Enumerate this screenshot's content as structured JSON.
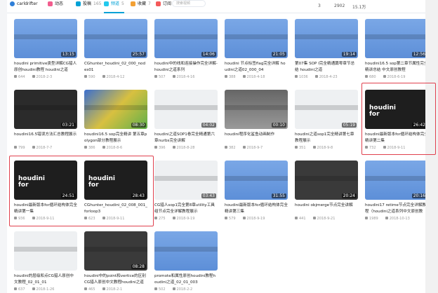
{
  "nav": {
    "username": "carldrifter",
    "tabs": [
      {
        "label": "动态",
        "count": "",
        "color": "#f25d8e"
      },
      {
        "label": "投稿",
        "count": "165",
        "color": "#00a1d6"
      },
      {
        "label": "频道",
        "count": "5",
        "color": "#23c9ed",
        "active": true
      },
      {
        "label": "收藏",
        "count": "7",
        "color": "#f3a034"
      },
      {
        "label": "订阅",
        "count": "",
        "color": "#f45a5a"
      }
    ],
    "search_placeholder": "搜索视频",
    "stats": [
      "3",
      "2902",
      "15.1万"
    ]
  },
  "accent": "#00a1d6",
  "highlight": "#e0404e",
  "videos": [
    {
      "title": "houdini primitive类型详解CG猎人原创houdini教程 houdini之道",
      "plays": "644",
      "date": "2018-2-3",
      "duration": "13:15",
      "thumb": "blue"
    },
    {
      "title": "CGhunter_houdini_02_000_nodes01",
      "plays": "590",
      "date": "2018-4-12",
      "duration": "25:57",
      "thumb": "blue"
    },
    {
      "title": "houdini中的线和连接操作完全详解-houdini之道系列",
      "plays": "507",
      "date": "2018-4-16",
      "duration": "14:06",
      "thumb": "blue"
    },
    {
      "title": "houdini 节点标签flag完全详解 houdini之道02_000_04",
      "plays": "388",
      "date": "2018-4-18",
      "duration": "21:05",
      "thumb": "blue"
    },
    {
      "title": "第07集 SOP I完全精通篇零章节总结 houdini之道",
      "plays": "1036",
      "date": "2018-4-23",
      "duration": "19:14",
      "thumb": "blue"
    },
    {
      "title": "houdini16.5 sop第二章节属性完全精讲总结 中文原创教程",
      "plays": "680",
      "date": "2018-6-19",
      "duration": "12:56",
      "thumb": "blue"
    },
    {
      "title": "houdini16.5错误方法汇总教程展示",
      "plays": "799",
      "date": "2018-7-7",
      "duration": "03:21",
      "thumb": "dark"
    },
    {
      "title": "houdini16.5 sop完全精讲 第五章polygon部分教程展示",
      "plays": "386",
      "date": "2018-8-6",
      "duration": "08:30",
      "thumb": "color"
    },
    {
      "title": "houdini之道SOP1卷完全精通第六章nurbs完全讲解",
      "plays": "396",
      "date": "2018-8-28",
      "duration": "04:02",
      "thumb": "white"
    },
    {
      "title": "houdini程序化鲨鱼动画制作",
      "plays": "382",
      "date": "2018-9-7",
      "duration": "00:10",
      "thumb": "gray"
    },
    {
      "title": "houdini之道sop1完全精讲第七章教程展示",
      "plays": "351",
      "date": "2018-9-8",
      "duration": "05:19",
      "thumb": "white"
    },
    {
      "title": "houdini最新版本for循环结构体完全精讲第二集",
      "plays": "732",
      "date": "2018-9-11",
      "duration": "26:42",
      "thumb": "houdini"
    },
    {
      "title": "houdini最新版本for循环结构体完全精讲第一集",
      "plays": "936",
      "date": "2018-9-11",
      "duration": "24:51",
      "thumb": "houdini"
    },
    {
      "title": "CGhunter_houdini_02_008_001_forloop3",
      "plays": "623",
      "date": "2018-9-11",
      "duration": "28:43",
      "thumb": "houdini"
    },
    {
      "title": "CG猎人sop1完全第8章utility工具组节点完全详解教程展示",
      "plays": "275",
      "date": "2018-9-19",
      "duration": "03:43",
      "thumb": "white"
    },
    {
      "title": "houdini最新版本for循环结构体完全精讲第三集",
      "plays": "579",
      "date": "2018-9-19",
      "duration": "31:55",
      "thumb": "blue"
    },
    {
      "title": "houdini objmerge节点完全讲解",
      "plays": "441",
      "date": "2018-9-21",
      "duration": "20:24",
      "thumb": "darkgray"
    },
    {
      "title": "houdini17 retime节点完全详解教程（houdini之道系列中文原创教",
      "plays": "1989",
      "date": "2018-10-13",
      "duration": "20:16",
      "thumb": "blue"
    },
    {
      "title": "houdini的层级和点CG猎人原创中文教程_02_01_01",
      "plays": "637",
      "date": "2018-1-26",
      "duration": "",
      "thumb": "white"
    },
    {
      "title": "houdini中的point和vertice的区别CG猎人原创中文教程houdini之道",
      "plays": "465",
      "date": "2018-2-1",
      "duration": "08:28",
      "thumb": "darkgray"
    },
    {
      "title": "promote和属性原创houdini教程houdini之道_02_01_003",
      "plays": "502",
      "date": "2018-2-2",
      "duration": "",
      "thumb": "blue"
    }
  ]
}
